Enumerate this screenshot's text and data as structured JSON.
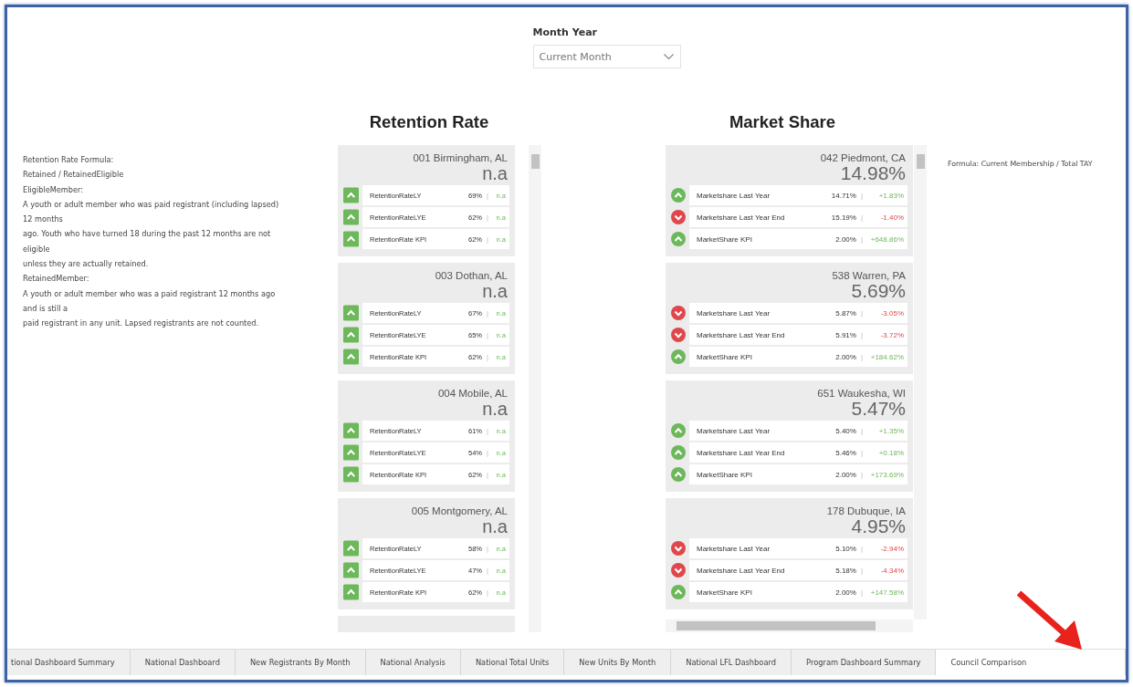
{
  "slicer": {
    "label": "Month Year",
    "value": "Current Month"
  },
  "notes": {
    "lines": [
      "Retention Rate Formula:",
      "Retained / RetainedEligible",
      "EligibleMember:",
      "A youth or adult member who was paid registrant (including lapsed) 12 months",
      "ago.  Youth who have turned 18 during the past 12 months are not eligible",
      "unless they are actually retained.",
      "RetainedMember:",
      "A youth or adult member who was a paid registrant 12 months ago and is still a",
      "paid registrant in any unit.  Lapsed registrants are not counted."
    ]
  },
  "panels": [
    {
      "kind": "retention",
      "title": "Retention Rate",
      "cards": [
        {
          "name": "001 Birmingham, AL",
          "value": "n.a",
          "rows": [
            {
              "label": "RetentionRateLY",
              "value": "69%",
              "sep": "|",
              "delta": "n.a",
              "up": true
            },
            {
              "label": "RetentionRateLYE",
              "value": "62%",
              "sep": "|",
              "delta": "n.a",
              "up": true
            },
            {
              "label": "RetentionRate KPI",
              "value": "62%",
              "sep": "|",
              "delta": "n.a",
              "up": true
            }
          ]
        },
        {
          "name": "003 Dothan, AL",
          "value": "n.a",
          "rows": [
            {
              "label": "RetentionRateLY",
              "value": "67%",
              "sep": "|",
              "delta": "n.a",
              "up": true
            },
            {
              "label": "RetentionRateLYE",
              "value": "65%",
              "sep": "|",
              "delta": "n.a",
              "up": true
            },
            {
              "label": "RetentionRate KPI",
              "value": "62%",
              "sep": "|",
              "delta": "n.a",
              "up": true
            }
          ]
        },
        {
          "name": "004 Mobile, AL",
          "value": "n.a",
          "rows": [
            {
              "label": "RetentionRateLY",
              "value": "61%",
              "sep": "|",
              "delta": "n.a",
              "up": true
            },
            {
              "label": "RetentionRateLYE",
              "value": "54%",
              "sep": "|",
              "delta": "n.a",
              "up": true
            },
            {
              "label": "RetentionRate KPI",
              "value": "62%",
              "sep": "|",
              "delta": "n.a",
              "up": true
            }
          ]
        },
        {
          "name": "005 Montgomery, AL",
          "value": "n.a",
          "rows": [
            {
              "label": "RetentionRateLY",
              "value": "58%",
              "sep": "|",
              "delta": "n.a",
              "up": true
            },
            {
              "label": "RetentionRateLYE",
              "value": "47%",
              "sep": "|",
              "delta": "n.a",
              "up": true
            },
            {
              "label": "RetentionRate KPI",
              "value": "62%",
              "sep": "|",
              "delta": "n.a",
              "up": true
            }
          ]
        }
      ]
    },
    {
      "kind": "market",
      "title": "Market Share",
      "note": "Formula: Current Membership / Total TAY",
      "cards": [
        {
          "name": "042 Piedmont, CA",
          "value": "14.98%",
          "rows": [
            {
              "label": "Marketshare Last Year",
              "value": "14.71%",
              "sep": "|",
              "delta": "+1.83%",
              "up": true
            },
            {
              "label": "Marketshare Last Year End",
              "value": "15.19%",
              "sep": "|",
              "delta": "-1.40%",
              "up": false
            },
            {
              "label": "MarketShare KPI",
              "value": "2.00%",
              "sep": "|",
              "delta": "+648.86%",
              "up": true
            }
          ]
        },
        {
          "name": "538 Warren, PA",
          "value": "5.69%",
          "rows": [
            {
              "label": "Marketshare Last Year",
              "value": "5.87%",
              "sep": "|",
              "delta": "-3.05%",
              "up": false
            },
            {
              "label": "Marketshare Last Year End",
              "value": "5.91%",
              "sep": "|",
              "delta": "-3.72%",
              "up": false
            },
            {
              "label": "MarketShare KPI",
              "value": "2.00%",
              "sep": "|",
              "delta": "+184.62%",
              "up": true
            }
          ]
        },
        {
          "name": "651 Waukesha, WI",
          "value": "5.47%",
          "rows": [
            {
              "label": "Marketshare Last Year",
              "value": "5.40%",
              "sep": "|",
              "delta": "+1.35%",
              "up": true
            },
            {
              "label": "Marketshare Last Year End",
              "value": "5.46%",
              "sep": "|",
              "delta": "+0.18%",
              "up": true
            },
            {
              "label": "MarketShare KPI",
              "value": "2.00%",
              "sep": "|",
              "delta": "+173.69%",
              "up": true
            }
          ]
        },
        {
          "name": "178 Dubuque, IA",
          "value": "4.95%",
          "rows": [
            {
              "label": "Marketshare Last Year",
              "value": "5.10%",
              "sep": "|",
              "delta": "-2.94%",
              "up": false
            },
            {
              "label": "Marketshare Last Year End",
              "value": "5.18%",
              "sep": "|",
              "delta": "-4.34%",
              "up": false
            },
            {
              "label": "MarketShare KPI",
              "value": "2.00%",
              "sep": "|",
              "delta": "+147.58%",
              "up": true
            }
          ]
        }
      ]
    }
  ],
  "tabs": [
    {
      "label": "tional Dashboard Summary",
      "selected": false
    },
    {
      "label": "National Dashboard",
      "selected": false
    },
    {
      "label": "New Registrants By Month",
      "selected": false
    },
    {
      "label": "National Analysis",
      "selected": false
    },
    {
      "label": "National Total Units",
      "selected": false
    },
    {
      "label": "New Units By Month",
      "selected": false
    },
    {
      "label": "National LFL Dashboard",
      "selected": false
    },
    {
      "label": "Program Dashboard Summary",
      "selected": false
    },
    {
      "label": "Council Comparison",
      "selected": true
    }
  ]
}
